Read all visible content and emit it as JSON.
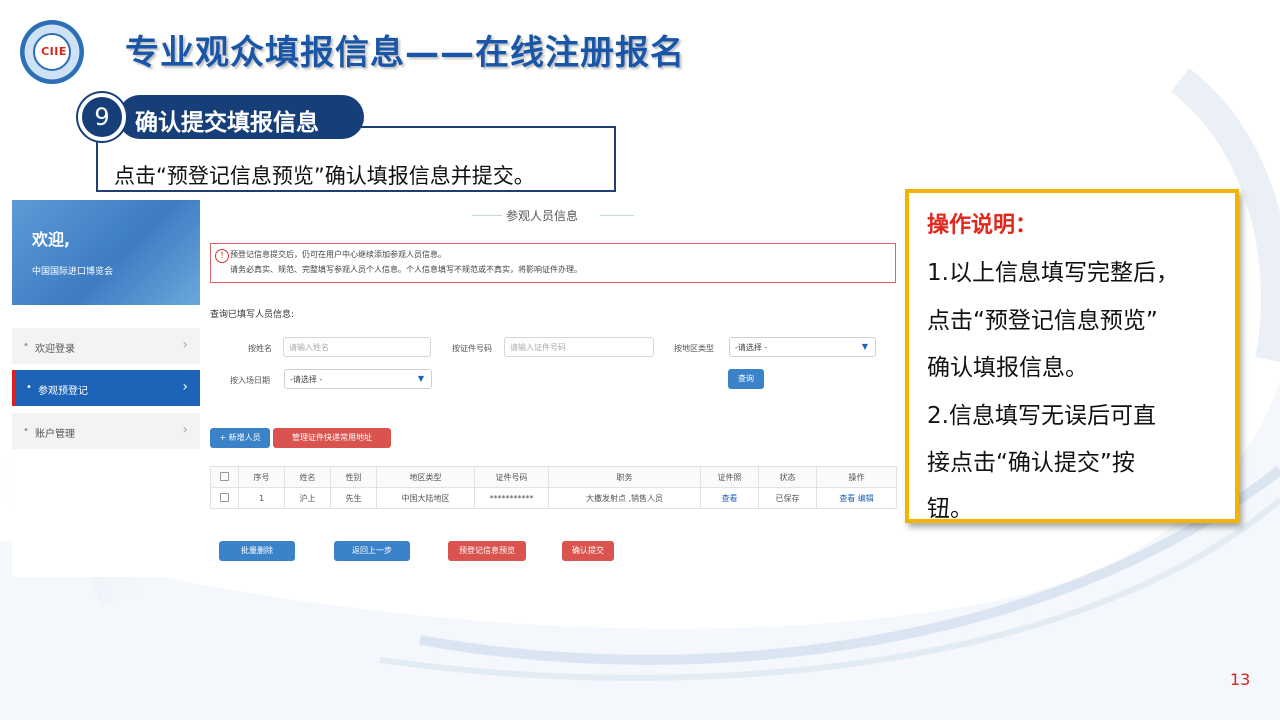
{
  "header": {
    "title": "专业观众填报信息——在线注册报名",
    "logo_text": "CIIE"
  },
  "step": {
    "number": "9",
    "label": "确认提交填报信息",
    "description": "点击“预登记信息预览”确认填报信息并提交。"
  },
  "sidebar": {
    "welcome_title": "欢迎,",
    "welcome_sub": "中国国际进口博览会",
    "items": [
      {
        "label": "欢迎登录",
        "active": false
      },
      {
        "label": "参观预登记",
        "active": true
      },
      {
        "label": "账户管理",
        "active": false
      }
    ]
  },
  "panel": {
    "title": "参观人员信息",
    "notice_line1": "预登记信息提交后，仍可在用户中心继续添加参观人员信息。",
    "notice_line2": "请务必真实、规范、完整填写参观人员个人信息。个人信息填写不规范或不真实，将影响证件办理。",
    "query_title": "查询已填写人员信息:",
    "filters": {
      "name_label": "按姓名",
      "name_placeholder": "请输入姓名",
      "id_label": "按证件号码",
      "id_placeholder": "请输入证件号码",
      "region_label": "按地区类型",
      "region_value": "-请选择 -",
      "date_label": "按入场日期",
      "date_value": "-请选择 -",
      "search_button": "查询"
    },
    "add_button": "+ 新增人员",
    "express_button": "管理证件快递常用地址",
    "table": {
      "headers": [
        "序号",
        "姓名",
        "性别",
        "地区类型",
        "证件号码",
        "职务",
        "证件照",
        "状态",
        "操作"
      ],
      "rows": [
        {
          "no": "1",
          "name": "沪上",
          "gender": "先生",
          "region": "中国大陆地区",
          "id": "***********",
          "position": "大撒发射点 ,销售人员",
          "photo": "查看",
          "status": "已保存",
          "op_view": "查看",
          "op_edit": "编辑"
        }
      ]
    },
    "actions": {
      "batch_delete": "批量删除",
      "back": "返回上一步",
      "preview": "预登记信息预览",
      "confirm": "确认提交"
    }
  },
  "info": {
    "title": "操作说明：",
    "lines": [
      "1.以上信息填写完整后，",
      "点击“预登记信息预览”",
      "确认填报信息。",
      "2.信息填写无误后可直",
      "接点击“确认提交”按",
      "钮。"
    ]
  },
  "page_number": "13",
  "colors": {
    "title_blue": "#1a56a8",
    "navy": "#163f7a",
    "info_border": "#f2b400",
    "info_title": "#e1261c",
    "active_nav": "#1d63b8",
    "danger": "#d9534f"
  }
}
